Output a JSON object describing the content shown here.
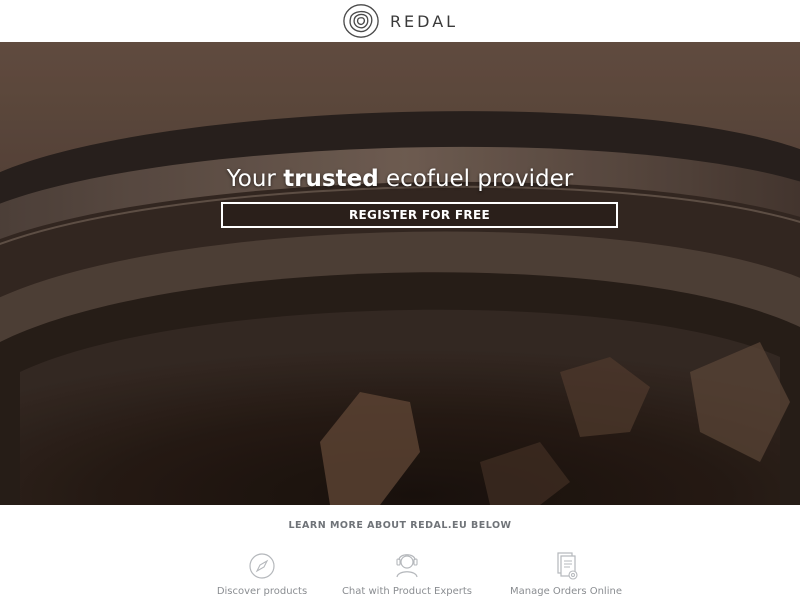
{
  "brand": {
    "name": "REDAL"
  },
  "hero": {
    "title_pre": "Your ",
    "title_strong": "trusted",
    "title_post": " ecofuel provider",
    "register_label": "REGISTER FOR FREE"
  },
  "learn_more": "LEARN MORE ABOUT REDAL.EU BELOW",
  "features": [
    {
      "label": "Discover products",
      "icon": "compass-icon"
    },
    {
      "label": "Chat with Product Experts",
      "icon": "chat-expert-icon"
    },
    {
      "label": "Manage Orders Online",
      "icon": "orders-document-icon"
    }
  ],
  "colors": {
    "brand_text": "#3a3a3a",
    "muted_text": "#8a8d91",
    "hero_text": "#ffffff"
  }
}
